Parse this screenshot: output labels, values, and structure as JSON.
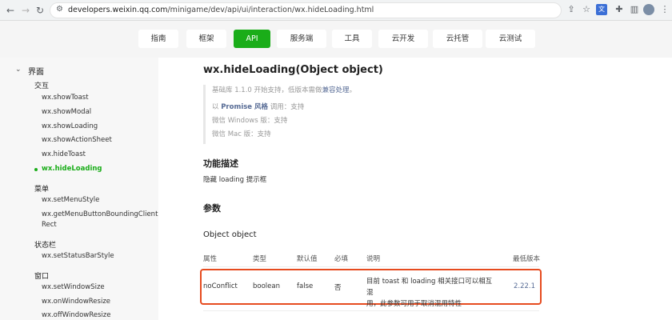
{
  "browser": {
    "url_host": "developers.weixin.qq.com",
    "url_path": "/minigame/dev/api/ui/interaction/wx.hideLoading.html"
  },
  "topnav": {
    "tabs": [
      {
        "label": "指南"
      },
      {
        "label": "框架"
      },
      {
        "label": "API"
      },
      {
        "label": "服务端"
      },
      {
        "label": "工具"
      },
      {
        "label": "云开发"
      },
      {
        "label": "云托管"
      },
      {
        "label": "云测试"
      }
    ],
    "active_index": 2,
    "accent": "#1aad19"
  },
  "sidebar": {
    "root": "界面",
    "groups": [
      {
        "label": "交互",
        "items": [
          "wx.showToast",
          "wx.showModal",
          "wx.showLoading",
          "wx.showActionSheet",
          "wx.hideToast",
          "wx.hideLoading"
        ]
      },
      {
        "label": "菜单",
        "items": [
          "wx.setMenuStyle",
          "wx.getMenuButtonBoundingClient",
          "Rect"
        ]
      },
      {
        "label": "状态栏",
        "items": [
          "wx.setStatusBarStyle"
        ]
      },
      {
        "label": "窗口",
        "items": [
          "wx.setWindowSize",
          "wx.onWindowResize",
          "wx.offWindowResize"
        ]
      }
    ],
    "active_item": "wx.hideLoading"
  },
  "main": {
    "title": "wx.hideLoading(Object object)",
    "support": {
      "line1_prefix": "基础库 1.1.0 开始支持，低版本需做",
      "line1_link": "兼容处理",
      "line1_suffix": "。",
      "line2_prefix": "以 ",
      "line2_strong": "Promise 风格",
      "line2_suffix": " 调用：支持",
      "line3": "微信 Windows 版：支持",
      "line4": "微信 Mac 版：支持"
    },
    "section_desc_title": "功能描述",
    "section_desc_text": "隐藏 loading 提示框",
    "section_params_title": "参数",
    "object_title": "Object object",
    "table": {
      "headers": [
        "属性",
        "类型",
        "默认值",
        "必填",
        "说明",
        "最低版本"
      ],
      "row": {
        "name": "noConflict",
        "type": "boolean",
        "default": "false",
        "required": "否",
        "desc_line1": "目前 toast 和 loading 相关接口可以相互混",
        "desc_line2": "用，此参数可用于取消混用特性",
        "version": "2.22.1"
      }
    }
  }
}
